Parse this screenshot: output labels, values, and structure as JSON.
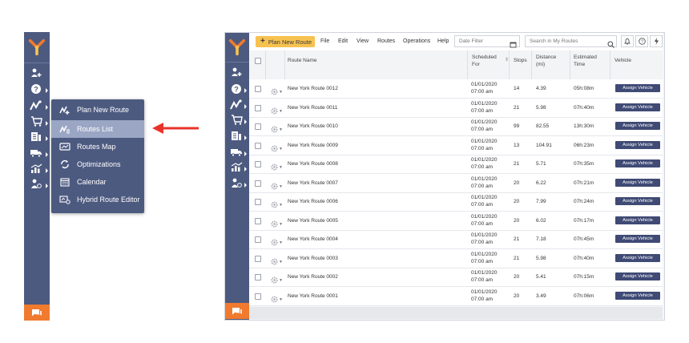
{
  "colors": {
    "sidebar": "#4d5a80",
    "active_item": "#9aa6c4",
    "accent_orange": "#f07a2e",
    "plan_button": "#f7c24f",
    "assign_button": "#3f4a75",
    "arrow": "#e8332b"
  },
  "sidebar_icons": [
    "add-user-icon",
    "help-icon",
    "routes-icon",
    "cart-icon",
    "document-icon",
    "truck-icon",
    "analytics-icon",
    "team-icon",
    "chat-icon"
  ],
  "flyout": {
    "items": [
      {
        "label": "Plan New Route",
        "icon": "plan-route-icon"
      },
      {
        "label": "Routes List",
        "icon": "routes-list-icon",
        "active": true
      },
      {
        "label": "Routes Map",
        "icon": "map-icon"
      },
      {
        "label": "Optimizations",
        "icon": "optimizations-icon"
      },
      {
        "label": "Calendar",
        "icon": "calendar-icon"
      },
      {
        "label": "Hybrid Route Editor",
        "icon": "hybrid-editor-icon"
      }
    ]
  },
  "toolbar": {
    "plan_button": "Plan New Route",
    "menu": [
      "File",
      "Edit",
      "View",
      "Routes",
      "Operations",
      "Help"
    ],
    "date_filter_placeholder": "Date Filter",
    "search_placeholder": "Search in My Routes"
  },
  "table": {
    "headers": {
      "route_name": "Route Name",
      "scheduled_1": "Scheduled",
      "scheduled_2": "For",
      "stops": "Stops",
      "distance_1": "Distance",
      "distance_2": "(mi)",
      "time_1": "Estimated",
      "time_2": "Time",
      "vehicle": "Vehicle"
    },
    "rows": [
      {
        "name": "New York Route 0012",
        "date": "01/01/2020",
        "time": "07:00 am",
        "stops": "14",
        "distance": "4.39",
        "est": "05h:08m",
        "action": "Assign Vehicle"
      },
      {
        "name": "New York Route 0011",
        "date": "01/01/2020",
        "time": "07:00 am",
        "stops": "21",
        "distance": "5.98",
        "est": "07h:40m",
        "action": "Assign Vehicle"
      },
      {
        "name": "New York Route 0010",
        "date": "01/01/2020",
        "time": "07:00 am",
        "stops": "99",
        "distance": "82.55",
        "est": "13h:30m",
        "action": "Assign Vehicle"
      },
      {
        "name": "New York Route 0009",
        "date": "01/01/2020",
        "time": "07:00 am",
        "stops": "13",
        "distance": "104.91",
        "est": "06h:23m",
        "action": "Assign Vehicle"
      },
      {
        "name": "New York Route 0008",
        "date": "01/01/2020",
        "time": "07:00 am",
        "stops": "21",
        "distance": "5.71",
        "est": "07h:35m",
        "action": "Assign Vehicle"
      },
      {
        "name": "New York Route 0007",
        "date": "01/01/2020",
        "time": "07:00 am",
        "stops": "20",
        "distance": "6.22",
        "est": "07h:21m",
        "action": "Assign Vehicle"
      },
      {
        "name": "New York Route 0006",
        "date": "01/01/2020",
        "time": "07:00 am",
        "stops": "20",
        "distance": "7.99",
        "est": "07h:24m",
        "action": "Assign Vehicle"
      },
      {
        "name": "New York Route 0005",
        "date": "01/01/2020",
        "time": "07:00 am",
        "stops": "20",
        "distance": "6.02",
        "est": "07h:17m",
        "action": "Assign Vehicle"
      },
      {
        "name": "New York Route 0004",
        "date": "01/01/2020",
        "time": "07:00 am",
        "stops": "21",
        "distance": "7.18",
        "est": "07h:45m",
        "action": "Assign Vehicle"
      },
      {
        "name": "New York Route 0003",
        "date": "01/01/2020",
        "time": "07:00 am",
        "stops": "21",
        "distance": "5.98",
        "est": "07h:40m",
        "action": "Assign Vehicle"
      },
      {
        "name": "New York Route 0002",
        "date": "01/01/2020",
        "time": "07:00 am",
        "stops": "20",
        "distance": "5.41",
        "est": "07h:15m",
        "action": "Assign Vehicle"
      },
      {
        "name": "New York Route 0001",
        "date": "01/01/2020",
        "time": "07:00 am",
        "stops": "20",
        "distance": "3.49",
        "est": "07h:06m",
        "action": "Assign Vehicle"
      }
    ]
  }
}
